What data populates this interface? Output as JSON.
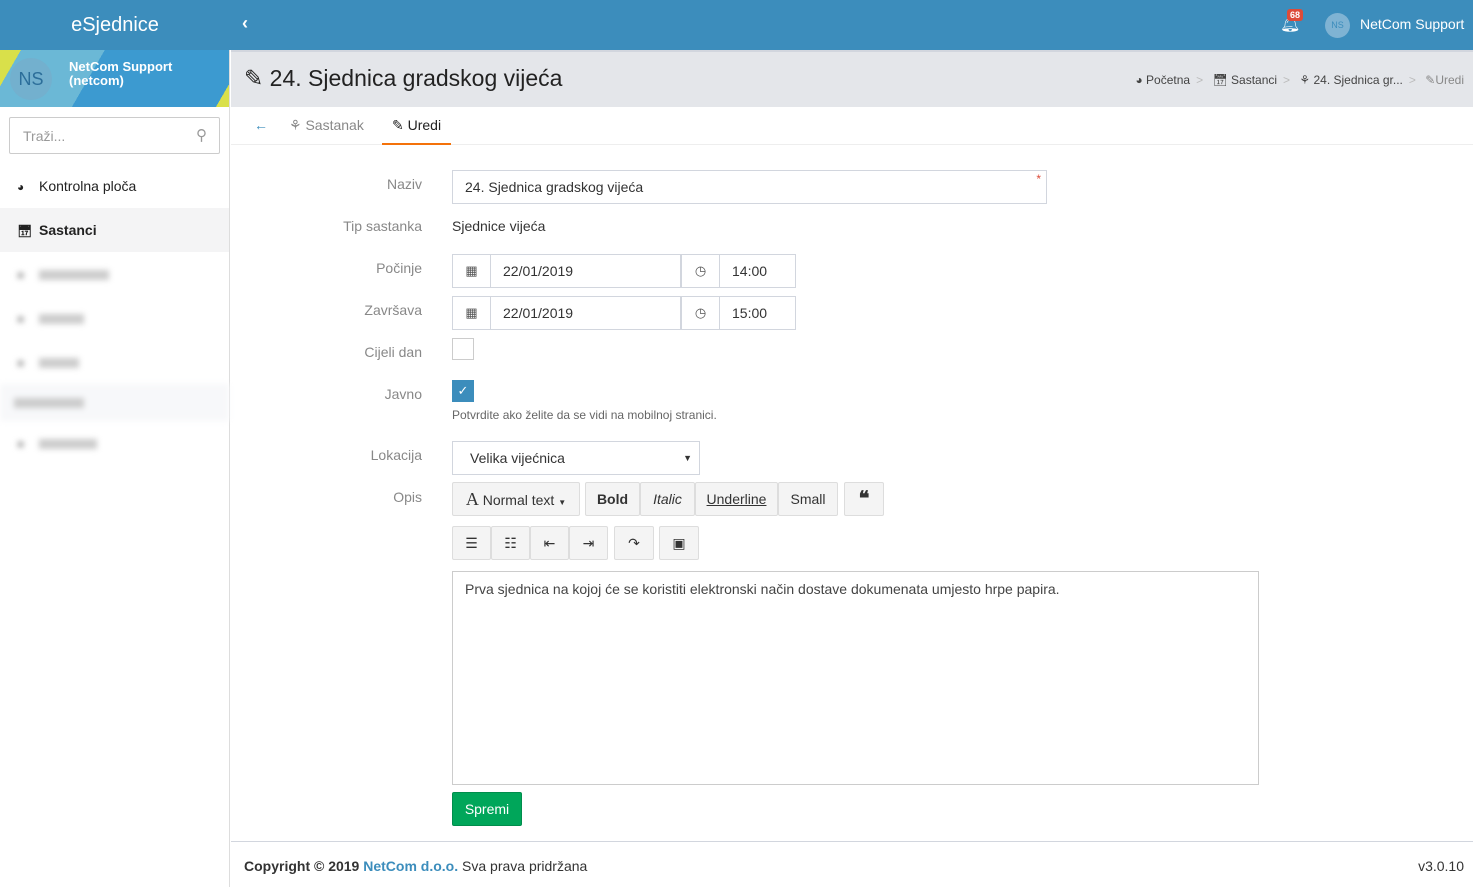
{
  "app": {
    "title": "eSjednice",
    "toggle_icon": "chevron-left-icon"
  },
  "topbar": {
    "notifications": "68",
    "user_initials": "NS",
    "user_name": "NetCom Support"
  },
  "sidebar": {
    "user_initials": "NS",
    "user_name": "NetCom Support",
    "user_login": "(netcom)",
    "search_placeholder": "Traži...",
    "items": [
      {
        "label": "Kontrolna ploča",
        "icon": "dashboard-icon"
      },
      {
        "label": "Sastanci",
        "icon": "calendar-check-icon",
        "active": true
      }
    ]
  },
  "header": {
    "title": "24. Sjednica gradskog vijeća",
    "breadcrumb": [
      "Početna",
      "Sastanci",
      "24. Sjednica gr...",
      "Uredi"
    ]
  },
  "tabs": [
    {
      "label": "Sastanak"
    },
    {
      "label": "Uredi",
      "active": true
    }
  ],
  "form": {
    "naziv_label": "Naziv",
    "naziv_value": "24. Sjednica gradskog vijeća",
    "required_mark": "*",
    "tip_label": "Tip sastanka",
    "tip_value": "Sjednice vijeća",
    "pocinje_label": "Počinje",
    "pocinje_date": "22/01/2019",
    "pocinje_time": "14:00",
    "zavrsava_label": "Završava",
    "zavrsava_date": "22/01/2019",
    "zavrsava_time": "15:00",
    "cijeli_label": "Cijeli dan",
    "cijeli_checked": false,
    "javno_label": "Javno",
    "javno_checked": true,
    "javno_help": "Potvrdite ako želite da se vidi na mobilnoj stranici.",
    "lokacija_label": "Lokacija",
    "lokacija_value": "Velika vijećnica",
    "opis_label": "Opis",
    "toolbar": {
      "normal_text": "Normal text",
      "bold": "Bold",
      "italic": "Italic",
      "underline": "Underline",
      "small": "Small",
      "quote": "❝"
    },
    "opis_value": "Prva sjednica na kojoj će se koristiti elektronski način dostave dokumenata umjesto hrpe papira.",
    "save": "Spremi"
  },
  "footer": {
    "copyright": "Copyright © 2019 ",
    "company": "NetCom d.o.o.",
    "rights": " Sva prava pridržana",
    "version": "v3.0.10"
  },
  "colors": {
    "primary": "#3c8dbc",
    "accent": "#f4720a",
    "success": "#00a65a",
    "badge": "#dd4b39"
  }
}
